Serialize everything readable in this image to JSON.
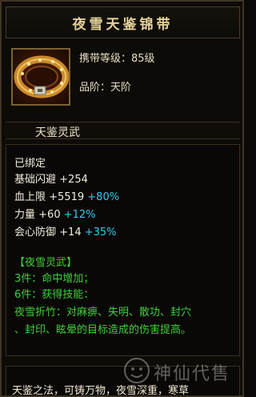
{
  "item": {
    "title": "夜雪天鉴锦带",
    "carry_level": "携带等级：85级",
    "grade": "品阶：天阶",
    "section": "天鉴灵武"
  },
  "stats": {
    "bound": "已绑定",
    "lines": [
      {
        "name": "基础闪避",
        "value": "+254",
        "percent": ""
      },
      {
        "name": "血上限",
        "value": "+5519",
        "percent": "+80%"
      },
      {
        "name": "力量",
        "value": "+60",
        "percent": "+12%"
      },
      {
        "name": "会心防御",
        "value": "+14",
        "percent": "+35%"
      }
    ]
  },
  "set": {
    "name": "【夜雪灵武】",
    "piece3": "3件：命中增加；",
    "piece6": "6件：获得技能：",
    "skill_line1": "夜雪折竹：对麻痹、失明、散功、封穴",
    "skill_line2": "、封印、眩晕的目标造成的伤害提高。"
  },
  "footer": {
    "text": "天鉴之法，可铸万物，夜雪深重，寒草"
  },
  "watermark": {
    "text": "神仙代售"
  }
}
